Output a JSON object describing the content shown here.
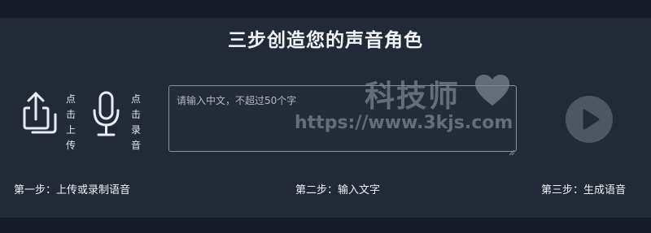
{
  "page": {
    "title": "三步创造您的声音角色"
  },
  "upload": {
    "icon": "upload-icon",
    "label": "点击上传"
  },
  "record": {
    "icon": "microphone-icon",
    "label": "点击录音"
  },
  "text_input": {
    "placeholder": "请输入中文，不超过50个字",
    "value": ""
  },
  "play": {
    "icon": "play-icon"
  },
  "watermark": {
    "text": "科技师",
    "url": "https://www.3kjs.com",
    "icon": "heart-icon"
  },
  "steps": [
    {
      "label": "第一步：上传或录制语音"
    },
    {
      "label": "第二步：输入文字"
    },
    {
      "label": "第三步：生成语音"
    }
  ],
  "colors": {
    "background": "#141a26",
    "panel": "#232a37",
    "text": "#e9edf3",
    "play_button": "#4e5563",
    "watermark": "#7b8290"
  }
}
